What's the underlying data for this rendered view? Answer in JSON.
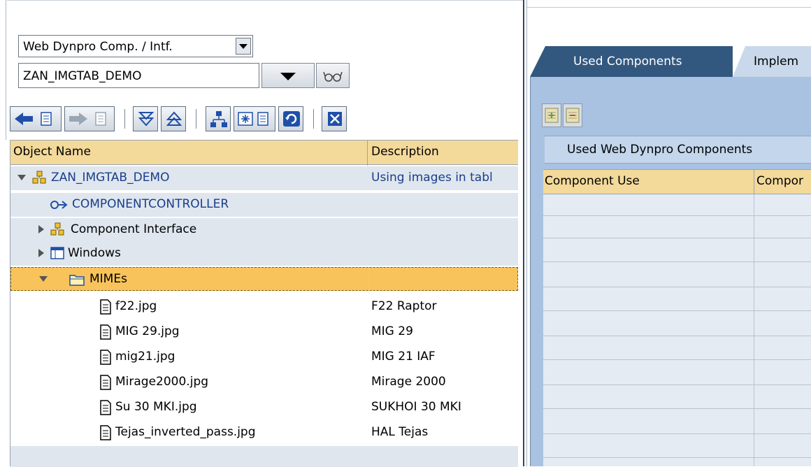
{
  "left_panel": {
    "object_type_select": "Web Dynpro Comp. / Intf.",
    "object_name_input": "ZAN_IMGTAB_DEMO"
  },
  "toolbar": {
    "buttons": [
      "back",
      "forward",
      "expand",
      "collapse",
      "hierarchy",
      "display-object",
      "refresh",
      "close"
    ]
  },
  "tree": {
    "columns": {
      "name": "Object Name",
      "description": "Description"
    },
    "root": {
      "name": "ZAN_IMGTAB_DEMO",
      "description": "Using images in tabl"
    },
    "nodes": [
      {
        "name": "COMPONENTCONTROLLER",
        "description": ""
      },
      {
        "name": "Component Interface",
        "description": ""
      },
      {
        "name": "Windows",
        "description": ""
      },
      {
        "name": "MIMEs",
        "description": ""
      }
    ],
    "files": [
      {
        "name": "f22.jpg",
        "description": "F22 Raptor"
      },
      {
        "name": "MIG 29.jpg",
        "description": "MIG 29"
      },
      {
        "name": "mig21.jpg",
        "description": "MIG 21 IAF"
      },
      {
        "name": "Mirage2000.jpg",
        "description": "Mirage 2000"
      },
      {
        "name": "Su 30 MKI.jpg",
        "description": "SUKHOI 30 MKI"
      },
      {
        "name": "Tejas_inverted_pass.jpg",
        "description": "HAL Tejas"
      }
    ]
  },
  "right_panel": {
    "tabs": [
      {
        "label": "Used Components",
        "active": true
      },
      {
        "label": "Implem",
        "active": false
      }
    ],
    "table_title": "Used Web Dynpro Components",
    "columns": [
      "Component Use",
      "Compor"
    ]
  },
  "colors": {
    "selected_row": "#f8c35a",
    "header": "#f3d99a",
    "tree_row": "#dfe6ee",
    "active_tab": "#33587f",
    "tab_body": "#a9c2e2"
  }
}
